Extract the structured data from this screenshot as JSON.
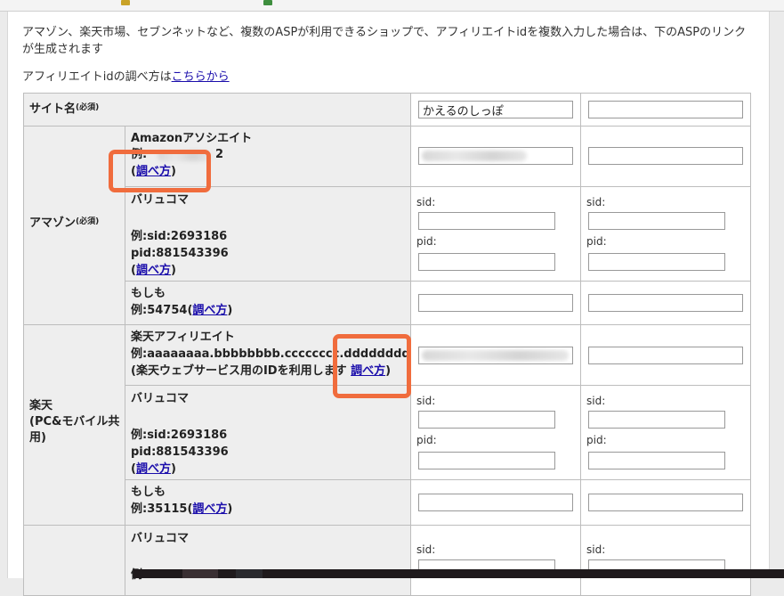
{
  "intro": {
    "note": "アマゾン、楽天市場、セブンネットなど、複数のASPが利用できるショップで、アフィリエイトidを複数入力した場合は、下のASPのリンクが生成されます",
    "howto_prefix": "アフィリエイトidの調べ方は",
    "howto_link": "こちらから"
  },
  "form": {
    "sitename": {
      "label": "サイト名",
      "required": "(必須)",
      "value1": "かえるのしっぽ",
      "value2": ""
    },
    "amazon": {
      "label": "アマゾン",
      "required": "(必須)",
      "associate": {
        "title": "Amazonアソシエイト",
        "example": "例:",
        "example_tail": "2",
        "link": "調べ方",
        "value2": ""
      },
      "valuecommerce": {
        "title": "バリュコマ",
        "ex_sid": "例:sid:2693186",
        "ex_pid": "pid:881543396",
        "link": "調べ方",
        "sid_label": "sid:",
        "pid_label": "pid:"
      },
      "moshimo": {
        "title": "もしも",
        "example": "例:54754",
        "link": "調べ方"
      }
    },
    "rakuten": {
      "label_line1": "楽天",
      "label_line2": "(PC&モバイル共",
      "label_line3": "用)",
      "affiliate": {
        "title": "楽天アフィリエイト",
        "example": "例:aaaaaaaa.bbbbbbbb.cccccccc.dddddddd",
        "note": "(楽天ウェブサービス用のIDを利用します",
        "link": "調べ方",
        "close": ")"
      },
      "valuecommerce": {
        "title": "バリュコマ",
        "ex_sid": "例:sid:2693186",
        "ex_pid": "pid:881543396",
        "link": "調べ方",
        "sid_label": "sid:",
        "pid_label": "pid:"
      },
      "moshimo": {
        "title": "もしも",
        "example": "例:35115",
        "link": "調べ方"
      }
    },
    "next": {
      "valuecommerce": {
        "title": "バリュコマ",
        "example": "例",
        "sid_label": "sid:"
      }
    }
  },
  "colors": {
    "highlight": "#f06c3d",
    "link": "#1a0dab",
    "label_bg": "#eeeeee",
    "border": "#bdbdbd"
  }
}
